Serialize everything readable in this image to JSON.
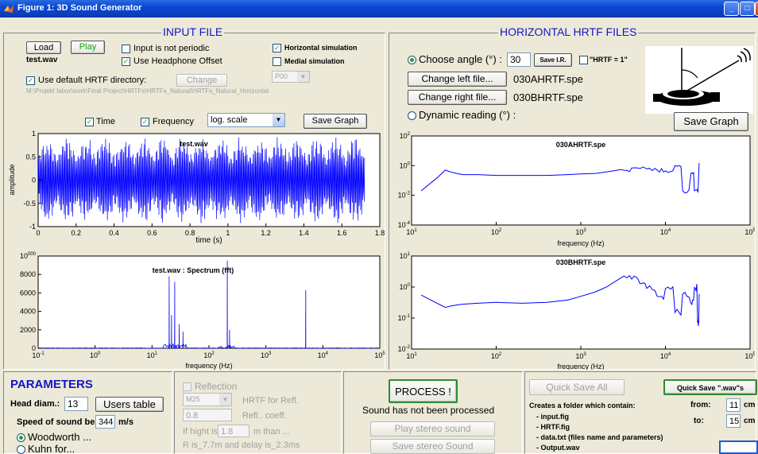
{
  "window": {
    "title": "Figure 1: 3D Sound Generator"
  },
  "input_file": {
    "title": "INPUT FILE",
    "load_label": "Load",
    "play_label": "Play",
    "filename": "test.wav",
    "not_periodic_label": "Input is not periodic",
    "not_periodic_checked": false,
    "headphone_offset_label": "Use Headphone Offset",
    "headphone_offset_checked": true,
    "horizontal_sim_label": "Horizontal simulation",
    "horizontal_sim_checked": true,
    "medial_sim_label": "Medial simulation",
    "medial_sim_checked": false,
    "default_hrtf_label": "Use default HRTF directory:",
    "default_hrtf_checked": true,
    "change_label": "Change",
    "dir_select": "P00",
    "dir_path": "M:\\Projekt labor\\work\\Final Project\\HRTFs\\HRTFs_Natural\\HRTFs_Natural_Horizontal",
    "time_label": "Time",
    "time_checked": true,
    "frequency_label": "Frequency",
    "frequency_checked": true,
    "scale_select": "log. scale",
    "save_graph_label": "Save Graph"
  },
  "horizontal_hrtf": {
    "title": "HORIZONTAL HRTF FILES",
    "choose_angle_label": "Choose angle (°) :",
    "angle_value": "30",
    "save_ir_label": "Save I.R.",
    "hrtf1_label": "\"HRTF = 1\"",
    "hrtf1_checked": false,
    "change_left_label": "Change left file...",
    "left_file": "030AHRTF.spe",
    "change_right_label": "Change right file...",
    "right_file": "030BHRTF.spe",
    "dynamic_label": "Dynamic reading (°) :",
    "save_graph_label": "Save Graph"
  },
  "parameters": {
    "title": "PARAMETERS",
    "head_diam_label": "Head diam.:",
    "head_diam_value": "13",
    "users_table_label": "Users table",
    "speed_label": "Speed of sound be",
    "speed_value": "344",
    "speed_unit": "m/s",
    "woodworth_label": "Woodworth ...",
    "kuhn_label": "Kuhn for..."
  },
  "reflection": {
    "label": "Reflection",
    "material_select": "M25",
    "hrtf_refl_label": "HRTF for Refl.",
    "coeff_value": "0.8",
    "coeff_label": "Refl.. coeff.",
    "height_label": "If hight is",
    "height_value": "1.8",
    "than_label": "m than ...",
    "r_text": "R is_7.7m and delay is_2.3ms"
  },
  "process": {
    "process_label": "PROCESS !",
    "status": "Sound has not been processed",
    "play_stereo_label": "Play stereo sound",
    "save_stereo_label": "Save stereo Sound"
  },
  "save": {
    "quick_save_all_label": "Quick Save All",
    "quick_save_wavs_label": "Quick Save \".wav\"s",
    "folder_title": "Creates a folder which contain:",
    "folder_items": [
      "- input.fig",
      "- HRTF.fig",
      "- data.txt (files name and parameters)",
      "- Output.wav"
    ],
    "from_label": "from:",
    "from_value": "11",
    "to_label": "to:",
    "to_value": "15",
    "unit": "cm"
  },
  "colors": {
    "accent": "#1414c8",
    "plot_line": "#0000ff",
    "window_bg": "#ece9d8"
  },
  "chart_data": [
    {
      "type": "line",
      "title": "test.wav",
      "xlabel": "time (s)",
      "ylabel": "amplitude",
      "xlim": [
        0,
        1.8
      ],
      "ylim": [
        -1,
        1
      ],
      "xticks": [
        "0",
        "0.2",
        "0.4",
        "0.6",
        "0.8",
        "1",
        "1.2",
        "1.4",
        "1.6",
        "1.8"
      ],
      "yticks": [
        "1",
        "0.5",
        "0",
        "-0.5",
        "-1"
      ],
      "signal_duration": 1.72,
      "series": [
        {
          "values": "dense oscillating waveform between about -0.95 and 0.95 from 0 to 1.72 s"
        }
      ]
    },
    {
      "type": "line",
      "title": "test.wav : Spectrum (fft)",
      "xlabel": "frequency (Hz)",
      "xscale": "log",
      "xlim": [
        0.1,
        100000
      ],
      "ylim": [
        0,
        10000
      ],
      "xticks": [
        "10-1",
        "100",
        "101",
        "102",
        "103",
        "104",
        "105"
      ],
      "yticks": [
        "10000",
        "8000",
        "6000",
        "4000",
        "2000",
        "0"
      ],
      "peaks": [
        {
          "x": 20,
          "y": 7800
        },
        {
          "x": 22,
          "y": 3600
        },
        {
          "x": 25,
          "y": 7200
        },
        {
          "x": 30,
          "y": 2600
        },
        {
          "x": 35,
          "y": 1800
        },
        {
          "x": 210,
          "y": 9500
        },
        {
          "x": 230,
          "y": 2000
        },
        {
          "x": 5000,
          "y": 6300
        }
      ]
    },
    {
      "type": "line",
      "title": "030AHRTF.spe",
      "xlabel": "frequency (Hz)",
      "xscale": "log",
      "yscale": "log",
      "xlim": [
        10,
        100000
      ],
      "ylim": [
        0.0001,
        100
      ],
      "xticks": [
        "101",
        "102",
        "103",
        "104",
        "105"
      ],
      "yticks": [
        "102",
        "100",
        "10-2",
        "10-4"
      ],
      "x": [
        13,
        20,
        25,
        30,
        40,
        60,
        100,
        200,
        400,
        700,
        1000,
        1500,
        2000,
        3000,
        4000,
        6000,
        8000,
        10000,
        13000,
        16000,
        20000,
        22000,
        25000
      ],
      "y": [
        0.02,
        0.15,
        0.5,
        0.35,
        0.25,
        0.25,
        0.22,
        0.22,
        0.22,
        0.25,
        0.28,
        0.3,
        0.38,
        0.55,
        0.7,
        0.6,
        0.5,
        0.45,
        1.0,
        0.02,
        0.3,
        0.02,
        1.5
      ]
    },
    {
      "type": "line",
      "title": "030BHRTF.spe",
      "xlabel": "frequency (Hz)",
      "xscale": "log",
      "yscale": "log",
      "xlim": [
        10,
        100000
      ],
      "ylim": [
        0.01,
        10
      ],
      "xticks": [
        "101",
        "102",
        "103",
        "104",
        "105"
      ],
      "yticks": [
        "101",
        "100",
        "10-1",
        "10-2"
      ],
      "x": [
        13,
        20,
        25,
        30,
        40,
        60,
        100,
        200,
        400,
        700,
        1000,
        1500,
        2000,
        3000,
        4000,
        5000,
        6000,
        8000,
        10000,
        13000,
        16000,
        20000,
        22000,
        24000,
        25000
      ],
      "y": [
        0.55,
        0.3,
        0.22,
        0.25,
        0.28,
        0.3,
        0.32,
        0.3,
        0.32,
        0.38,
        0.5,
        0.7,
        1.0,
        2.0,
        1.8,
        1.3,
        0.9,
        0.5,
        0.9,
        0.15,
        0.6,
        0.3,
        1.0,
        0.07,
        0.6
      ]
    }
  ]
}
